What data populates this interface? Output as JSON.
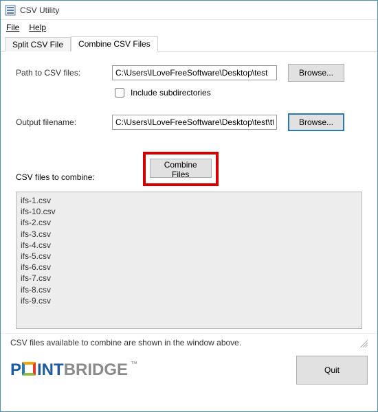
{
  "window": {
    "title": "CSV Utility"
  },
  "menu": {
    "file": "File",
    "help": "Help"
  },
  "tabs": {
    "split": "Split CSV File",
    "combine": "Combine CSV Files"
  },
  "labels": {
    "path": "Path to CSV files:",
    "include_sub": "Include subdirectories",
    "output": "Output filename:",
    "list_label": "CSV files to combine:",
    "hint": "CSV files available to combine are shown in the window above."
  },
  "inputs": {
    "path_value": "C:\\Users\\ILoveFreeSoftware\\Desktop\\test",
    "output_value": "C:\\Users\\ILoveFreeSoftware\\Desktop\\test\\tttttttt.csv"
  },
  "buttons": {
    "browse": "Browse...",
    "combine": "Combine Files",
    "quit": "Quit"
  },
  "files": [
    "ifs-1.csv",
    "ifs-10.csv",
    "ifs-2.csv",
    "ifs-3.csv",
    "ifs-4.csv",
    "ifs-5.csv",
    "ifs-6.csv",
    "ifs-7.csv",
    "ifs-8.csv",
    "ifs-9.csv"
  ],
  "logo": {
    "part1": "P",
    "part2": "INT",
    "part3": "BRIDGE",
    "tm": "™"
  }
}
